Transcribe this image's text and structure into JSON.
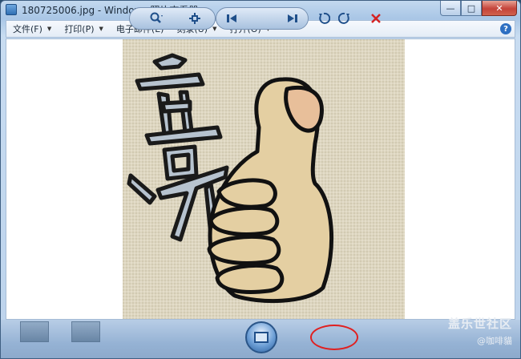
{
  "window": {
    "title": "180725006.jpg - Windows 照片查看器",
    "minimize": "—",
    "maximize": "□",
    "close": "✕"
  },
  "menu": {
    "items": [
      {
        "label": "文件(F)"
      },
      {
        "label": "打印(P)"
      },
      {
        "label": "电子邮件(E)"
      },
      {
        "label": "刻录(U)"
      },
      {
        "label": "打开(O)"
      }
    ],
    "help": "?"
  },
  "photo": {
    "calligraphy_text": "喜"
  },
  "toolbar": {
    "zoom_icon": "magnifier-icon",
    "fit_icon": "fit-window-icon",
    "prev_icon": "previous-icon",
    "slideshow_icon": "slideshow-icon",
    "next_icon": "next-icon",
    "rotate_ccw_icon": "rotate-counterclockwise-icon",
    "rotate_cw_icon": "rotate-clockwise-icon",
    "delete_icon": "delete-icon"
  },
  "watermark": {
    "line1": "盖乐世社区",
    "line2": "@咖啡貓"
  }
}
